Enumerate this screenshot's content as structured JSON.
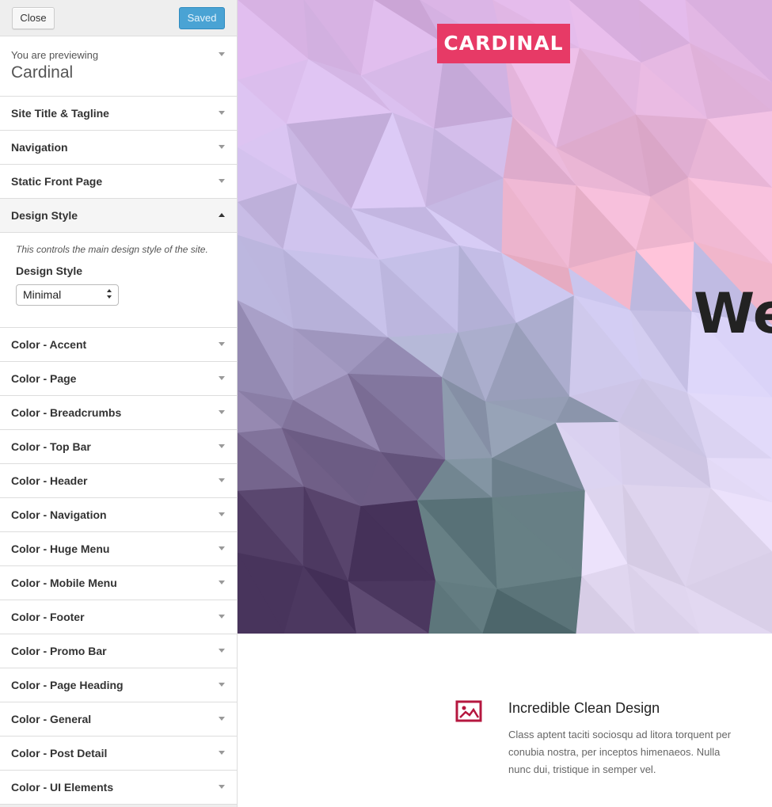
{
  "header": {
    "close_label": "Close",
    "saved_label": "Saved"
  },
  "preview_info": {
    "label": "You are previewing",
    "theme_name": "Cardinal"
  },
  "sections_top": [
    {
      "label": "Site Title & Tagline"
    },
    {
      "label": "Navigation"
    },
    {
      "label": "Static Front Page"
    }
  ],
  "design_style": {
    "label": "Design Style",
    "description": "This controls the main design style of the site.",
    "control_title": "Design Style",
    "selected_value": "Minimal"
  },
  "sections_bottom": [
    {
      "label": "Color - Accent"
    },
    {
      "label": "Color - Page"
    },
    {
      "label": "Color - Breadcrumbs"
    },
    {
      "label": "Color - Top Bar"
    },
    {
      "label": "Color - Header"
    },
    {
      "label": "Color - Navigation"
    },
    {
      "label": "Color - Huge Menu"
    },
    {
      "label": "Color - Mobile Menu"
    },
    {
      "label": "Color - Footer"
    },
    {
      "label": "Color - Promo Bar"
    },
    {
      "label": "Color - Page Heading"
    },
    {
      "label": "Color - General"
    },
    {
      "label": "Color - Post Detail"
    },
    {
      "label": "Color - UI Elements"
    }
  ],
  "preview": {
    "logo": "CARDINAL",
    "hero_heading": "We",
    "feature": {
      "icon": "image-icon",
      "title": "Incredible Clean Design",
      "text": "Class aptent taciti sociosqu ad litora torquent per conubia nostra, per inceptos himenaeos. Nulla nunc dui, tristique in semper vel."
    }
  },
  "colors": {
    "accent": "#e73a66",
    "saved_button": "#4aa3d4",
    "icon": "#b5173f"
  }
}
